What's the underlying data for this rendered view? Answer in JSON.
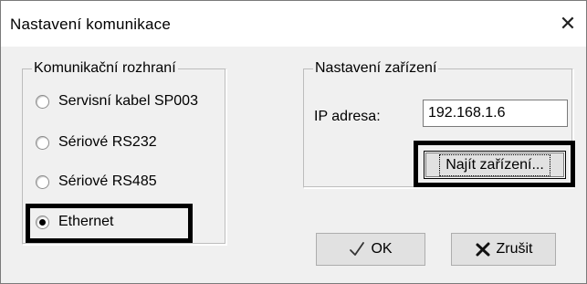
{
  "window": {
    "title": "Nastavení komunikace",
    "close_glyph": "✕"
  },
  "interface_group": {
    "legend": "Komunikační rozhraní",
    "options": [
      {
        "label": "Servisní kabel SP003",
        "selected": false
      },
      {
        "label": "Sériové RS232",
        "selected": false
      },
      {
        "label": "Sériové RS485",
        "selected": false
      },
      {
        "label": "Ethernet",
        "selected": true
      }
    ]
  },
  "device_group": {
    "legend": "Nastavení zařízení",
    "ip_label": "IP adresa:",
    "ip_value": "192.168.1.6",
    "find_button": "Najít zařízení..."
  },
  "buttons": {
    "ok_label": "OK",
    "ok_icon": "checkmark-icon",
    "cancel_label": "Zrušit",
    "cancel_icon": "x-icon"
  }
}
